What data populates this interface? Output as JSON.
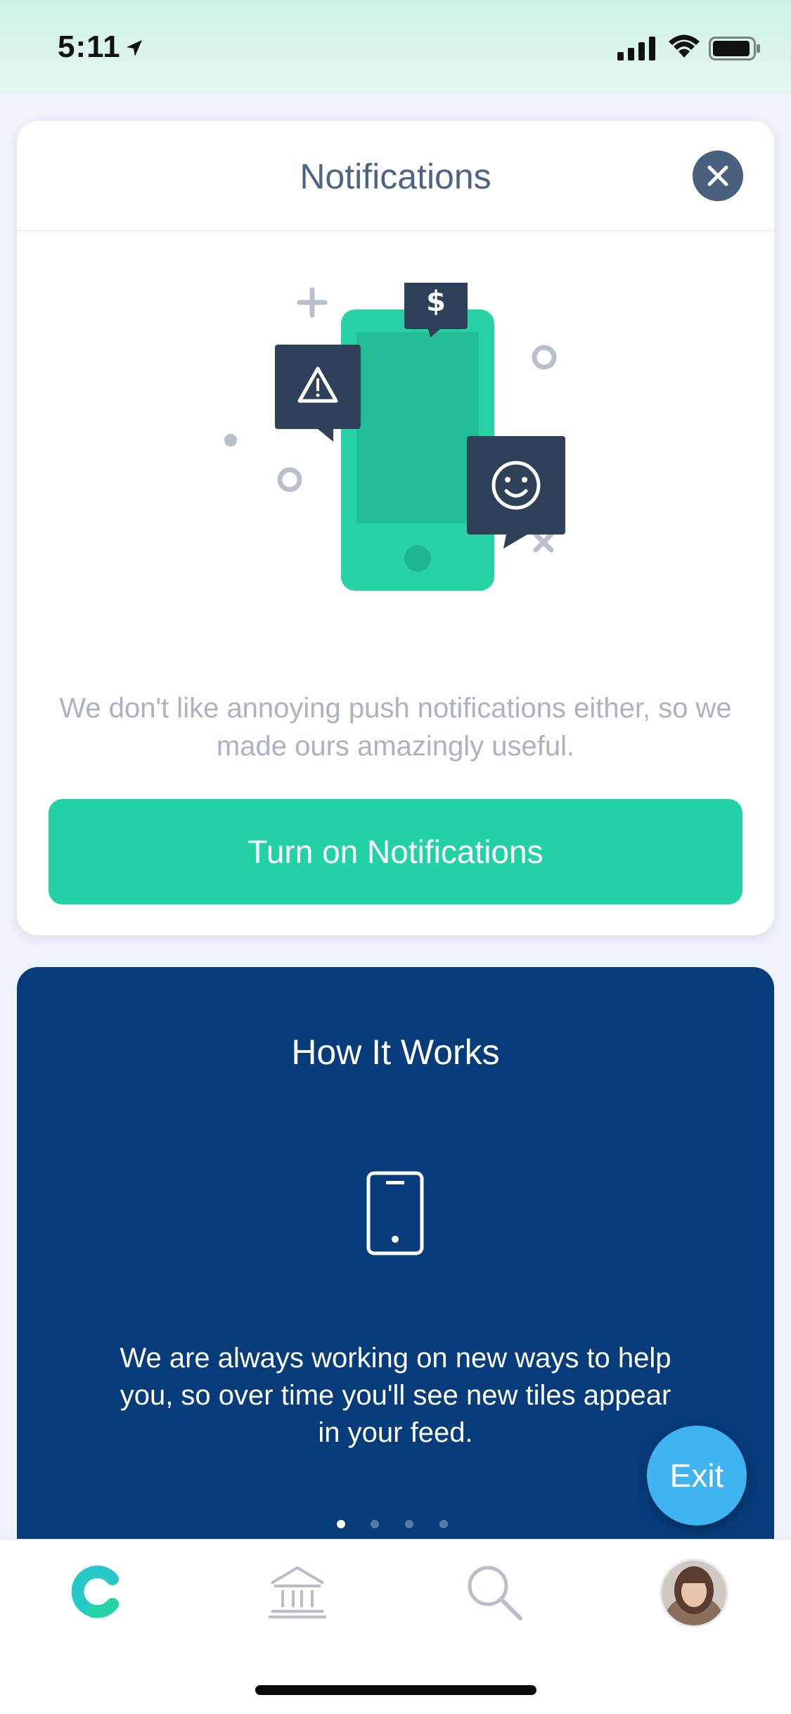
{
  "status_bar": {
    "time": "5:11"
  },
  "notifications_card": {
    "title": "Notifications",
    "description": "We don't like annoying push notifications either, so we made ours amazingly useful.",
    "button_label": "Turn on Notifications",
    "icons": [
      "dollar-bubble-icon",
      "warning-bubble-icon",
      "smiley-bubble-icon",
      "phone-icon"
    ]
  },
  "how_it_works": {
    "title": "How It Works",
    "description": "We are always working on new ways to help you, so over time you'll see new tiles appear in your feed.",
    "pages": 4,
    "active_page": 1
  },
  "exit_label": "Exit",
  "tab_bar": {
    "items": [
      "home-logo",
      "bank-icon",
      "search-icon",
      "profile-avatar"
    ]
  },
  "colors": {
    "accent": "#23d2a4",
    "navy": "#063c7a",
    "exit": "#3fb4f0",
    "text_muted": "#a9b3c2"
  }
}
